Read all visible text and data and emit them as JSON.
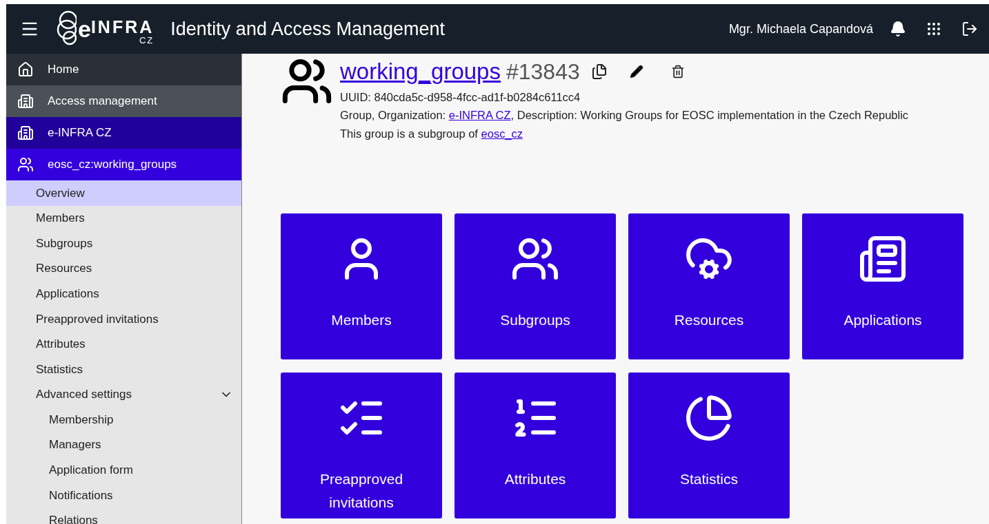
{
  "header": {
    "logo": {
      "letter": "e",
      "name": "INFRA",
      "country": "CZ"
    },
    "title": "Identity and Access Management",
    "user": "Mgr. Michaela Capandová"
  },
  "sidebar": {
    "items": [
      {
        "kind": "home",
        "label": "Home"
      },
      {
        "kind": "section",
        "label": "Access management"
      },
      {
        "kind": "organization",
        "label": "e-INFRA CZ"
      },
      {
        "kind": "group",
        "label": "eosc_cz:working_groups"
      }
    ],
    "menu": [
      {
        "label": "Overview",
        "selected": true
      },
      {
        "label": "Members",
        "selected": false
      },
      {
        "label": "Subgroups",
        "selected": false
      },
      {
        "label": "Resources",
        "selected": false
      },
      {
        "label": "Applications",
        "selected": false
      },
      {
        "label": "Preapproved invitations",
        "selected": false
      },
      {
        "label": "Attributes",
        "selected": false
      },
      {
        "label": "Statistics",
        "selected": false
      },
      {
        "label": "Advanced settings",
        "selected": false,
        "expanded": true,
        "children": [
          {
            "label": "Membership",
            "selected": false
          },
          {
            "label": "Managers",
            "selected": false
          },
          {
            "label": "Application form",
            "selected": false
          },
          {
            "label": "Notifications",
            "selected": false
          },
          {
            "label": "Relations",
            "selected": false
          }
        ]
      }
    ]
  },
  "group": {
    "name": "working_groups",
    "id": "#13843",
    "uuid": "UUID: 840cda5c-d958-4fcc-ad1f-b0284c611cc4",
    "info": {
      "before": "Group, Organization: ",
      "link": "e-INFRA CZ",
      "after": ", Description: Working Groups for EOSC implementation in the Czech Republic"
    },
    "parent": {
      "before": "This group is a subgroup of ",
      "link": "eosc_cz"
    }
  },
  "tiles": [
    {
      "kind": "members",
      "label": "Members"
    },
    {
      "kind": "subgroups",
      "label": "Subgroups"
    },
    {
      "kind": "resources",
      "label": "Resources"
    },
    {
      "kind": "applications",
      "label": "Applications"
    },
    {
      "kind": "invitations",
      "label": "Preapproved invitations"
    },
    {
      "kind": "attributes",
      "label": "Attributes"
    },
    {
      "kind": "statistics",
      "label": "Statistics"
    }
  ]
}
